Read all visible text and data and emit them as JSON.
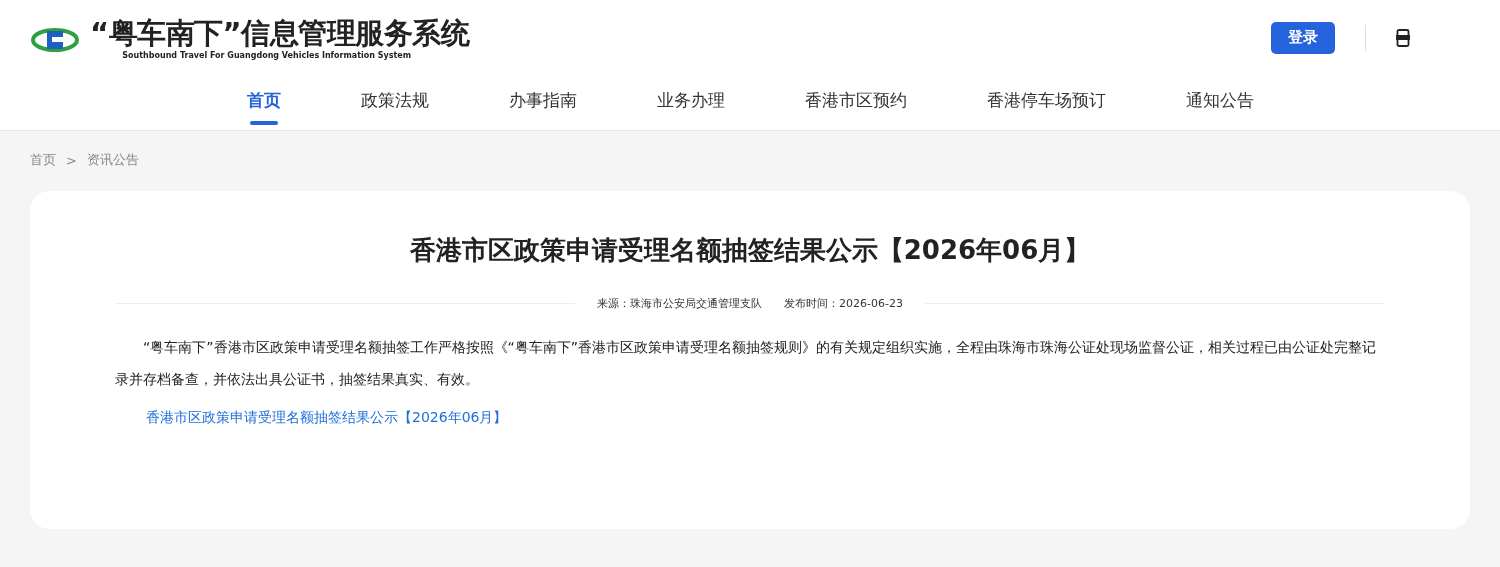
{
  "header": {
    "title": "“粤车南下”信息管理服务系统",
    "subtitle": "Southbound Travel For Guangdong Vehicles Information System",
    "login_button": "登录"
  },
  "nav": [
    {
      "label": "首页",
      "selected": true
    },
    {
      "label": "政策法规",
      "selected": false
    },
    {
      "label": "办事指南",
      "selected": false
    },
    {
      "label": "业务办理",
      "selected": false
    },
    {
      "label": "香港市区预约",
      "selected": false
    },
    {
      "label": "香港停车场预订",
      "selected": false
    },
    {
      "label": "通知公告",
      "selected": false
    }
  ],
  "breadcrumb": {
    "items": [
      "首页",
      "资讯公告"
    ],
    "separator": ">"
  },
  "article": {
    "title": "香港市区政策申请受理名额抽签结果公示【2026年06月】",
    "source": "来源：珠海市公安局交通管理支队",
    "published": "发布时间：2026-06-23",
    "paragraph": "“粤车南下”香港市区政策申请受理名额抽签工作严格按照《“粤车南下”香港市区政策申请受理名额抽签规则》的有关规定组织实施，全程由珠海市珠海公证处现场监督公证，相关过程已由公证处完整记录并存档备查，并依法出具公证书，抽签结果真实、有效。",
    "link": "香港市区政策申请受理名额抽签结果公示【2026年06月】"
  }
}
